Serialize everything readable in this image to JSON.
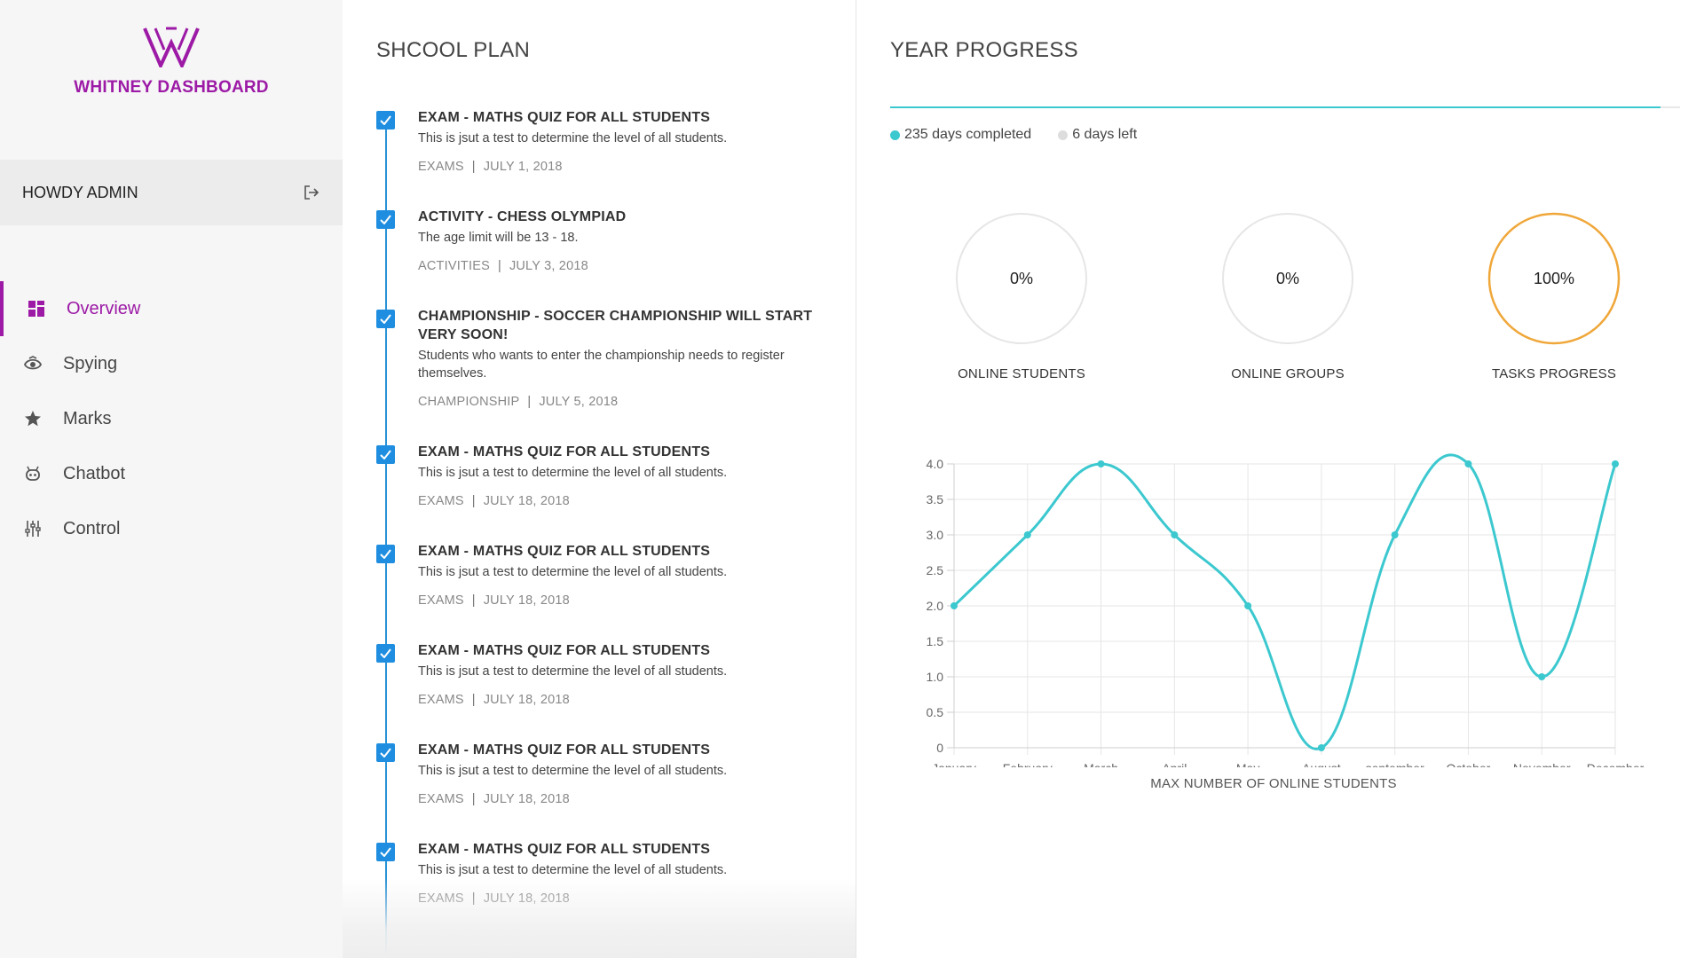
{
  "sidebar": {
    "brand": {
      "title": "WHITNEY DASHBOARD",
      "logo_icon": "w-logo-icon",
      "color": "#9c1aa6"
    },
    "user": {
      "greeting": "HOWDY ADMIN",
      "logout_icon": "logout-icon"
    },
    "nav": [
      {
        "label": "Overview",
        "icon": "dashboard-icon",
        "active": true
      },
      {
        "label": "Spying",
        "icon": "eye-icon",
        "active": false
      },
      {
        "label": "Marks",
        "icon": "star-icon",
        "active": false
      },
      {
        "label": "Chatbot",
        "icon": "robot-icon",
        "active": false
      },
      {
        "label": "Control",
        "icon": "sliders-icon",
        "active": false
      }
    ]
  },
  "plan": {
    "title": "SHCOOL PLAN",
    "items": [
      {
        "title": "EXAM - MATHS QUIZ FOR ALL STUDENTS",
        "desc": "This is jsut a test to determine the level of all students.",
        "category": "EXAMS",
        "date": "JULY 1, 2018"
      },
      {
        "title": "ACTIVITY - CHESS OLYMPIAD",
        "desc": "The age limit will be 13 - 18.",
        "category": "ACTIVITIES",
        "date": "JULY 3, 2018"
      },
      {
        "title": "CHAMPIONSHIP - SOCCER CHAMPIONSHIP WILL START VERY SOON!",
        "desc": "Students who wants to enter the championship needs to register themselves.",
        "category": "CHAMPIONSHIP",
        "date": "JULY 5, 2018"
      },
      {
        "title": "EXAM - MATHS QUIZ FOR ALL STUDENTS",
        "desc": "This is jsut a test to determine the level of all students.",
        "category": "EXAMS",
        "date": "JULY 18, 2018"
      },
      {
        "title": "EXAM - MATHS QUIZ FOR ALL STUDENTS",
        "desc": "This is jsut a test to determine the level of all students.",
        "category": "EXAMS",
        "date": "JULY 18, 2018"
      },
      {
        "title": "EXAM - MATHS QUIZ FOR ALL STUDENTS",
        "desc": "This is jsut a test to determine the level of all students.",
        "category": "EXAMS",
        "date": "JULY 18, 2018"
      },
      {
        "title": "EXAM - MATHS QUIZ FOR ALL STUDENTS",
        "desc": "This is jsut a test to determine the level of all students.",
        "category": "EXAMS",
        "date": "JULY 18, 2018"
      },
      {
        "title": "EXAM - MATHS QUIZ FOR ALL STUDENTS",
        "desc": "This is jsut a test to determine the level of all students.",
        "category": "EXAMS",
        "date": "JULY 18, 2018"
      }
    ],
    "check_color": "#1f8ee0"
  },
  "progress": {
    "title": "YEAR PROGRESS",
    "completed_label": "235 days completed",
    "left_label": "6 days left",
    "completed_fraction": 0.975,
    "colors": {
      "completed": "#3cc8cf",
      "left": "#dddddd"
    },
    "gauges": [
      {
        "value": "0%",
        "fraction": 0,
        "label": "ONLINE STUDENTS",
        "color": "#e8e8e8"
      },
      {
        "value": "0%",
        "fraction": 0,
        "label": "ONLINE GROUPS",
        "color": "#e8e8e8"
      },
      {
        "value": "100%",
        "fraction": 1,
        "label": "TASKS PROGRESS",
        "color": "#f0a73a"
      }
    ]
  },
  "chart_data": {
    "type": "line",
    "categories": [
      "January",
      "February",
      "March",
      "April",
      "May",
      "August",
      "september",
      "October",
      "November",
      "December"
    ],
    "series": [
      {
        "values": [
          2,
          3,
          4,
          3,
          2,
          0,
          3,
          4,
          1,
          4
        ],
        "color": "#3cc8cf"
      }
    ],
    "yticks": [
      "0",
      "0.5",
      "1.0",
      "1.5",
      "2.0",
      "2.5",
      "3.0",
      "3.5",
      "4.0"
    ],
    "ylim": [
      0,
      4
    ],
    "xlabel": "MAX NUMBER OF ONLINE STUDENTS",
    "grid": true
  }
}
